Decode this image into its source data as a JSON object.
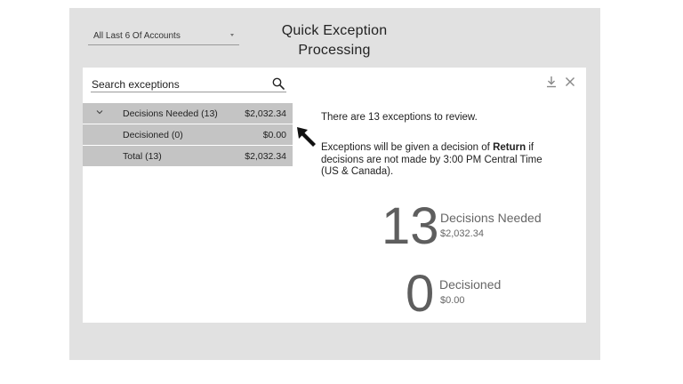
{
  "account_select": {
    "value": "All Last 6 Of Accounts"
  },
  "title": {
    "line1": "Quick Exception",
    "line2": "Processing"
  },
  "search": {
    "placeholder": "Search exceptions"
  },
  "icons": {
    "search": "search-icon",
    "download": "download-icon",
    "close": "close-icon",
    "expand": "chevron-down-icon",
    "pointer": "arrow-pointer-icon"
  },
  "list": {
    "rows": [
      {
        "label": "Decisions Needed (13)",
        "amount": "$2,032.34"
      },
      {
        "label": "Decisioned (0)",
        "amount": "$0.00"
      },
      {
        "label": "Total (13)",
        "amount": "$2,032.34"
      }
    ]
  },
  "message": {
    "line1": "There are 13 exceptions to review.",
    "line2_prefix": "Exceptions will be given a decision of ",
    "line2_bold": "Return",
    "line2_suffix": " if decisions are not made by 3:00 PM Central Time (US & Canada)."
  },
  "stats": {
    "needed": {
      "count": "13",
      "label": "Decisions Needed",
      "amount": "$2,032.34"
    },
    "decisioned": {
      "count": "0",
      "label": "Decisioned",
      "amount": "$0.00"
    }
  },
  "colors": {
    "frame_bg": "#e1e1e1",
    "row_bg": "#c4c4c4",
    "stat_text": "#5e5e5e"
  }
}
